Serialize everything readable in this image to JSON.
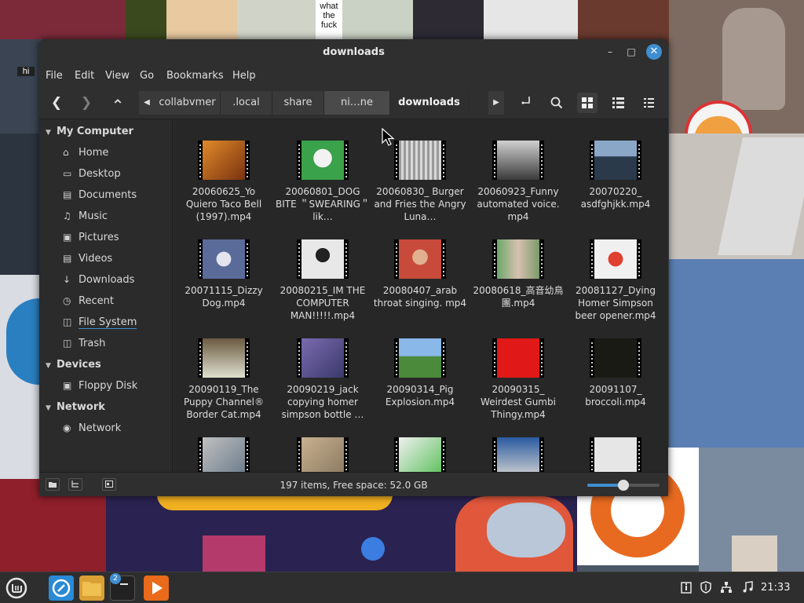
{
  "window": {
    "title": "downloads",
    "minimize_glyph": "–",
    "maximize_glyph": "□",
    "close_glyph": "✕"
  },
  "menu": [
    "File",
    "Edit",
    "Go",
    "Bookmarks",
    "Help",
    "View"
  ],
  "menu_labels": {
    "file": "File",
    "edit": "Edit",
    "view": "View",
    "go": "Go",
    "bookmarks": "Bookmarks",
    "help": "Help"
  },
  "toolbar": {
    "back_glyph": "❮",
    "forward_glyph": "❯",
    "up_glyph": "⌃"
  },
  "breadcrumbs": {
    "crumb0": "collabvmer",
    "crumb1": ".local",
    "crumb2": "share",
    "crumb3": "ni…ne",
    "crumb4": "downloads"
  },
  "sidebar": {
    "sections": {
      "my_computer": "My Computer",
      "devices": "Devices",
      "network": "Network"
    },
    "items": {
      "home": "Home",
      "desktop": "Desktop",
      "documents": "Documents",
      "music": "Music",
      "pictures": "Pictures",
      "videos": "Videos",
      "downloads": "Downloads",
      "recent": "Recent",
      "file_system": "File System",
      "trash": "Trash",
      "floppy": "Floppy Disk",
      "network": "Network"
    }
  },
  "files": [
    "20060625_Yo Quiero Taco Bell (1997).mp4",
    "20060801_DOG BITE ＂SWEARING＂ lik…",
    "20060830_ Burger and Fries the Angry Luna…",
    "20060923_Funny automated voice. mp4",
    "20070220_ asdfghjkk.mp4",
    "20071115_Dizzy Dog.mp4",
    "20080215_IM THE COMPUTER MAN!!!!!.mp4",
    "20080407_arab throat singing. mp4",
    "20080618_高音幼鳥團.mp4",
    "20081127_Dying Homer Simpson beer opener.mp4",
    "20090119_The Puppy Channel® Border Cat.mp4",
    "20090219_jack copying homer simpson bottle …",
    "20090314_Pig Explosion.mp4",
    "20090315_ Weirdest Gumbi Thingy.mp4",
    "20091107_ broccoli.mp4",
    "",
    "",
    "",
    "",
    ""
  ],
  "status": {
    "text": "197 items, Free space: 52.0 GB",
    "zoom_level": 0.5
  },
  "wallpaper_text": {
    "what": "what the fuck",
    "hi": "hi"
  },
  "taskbar": {
    "badge": "2",
    "clock": "21:33"
  },
  "colors": {
    "accent": "#3e8ed0",
    "window_bg": "#2b2b2b",
    "content_bg": "#272727"
  }
}
